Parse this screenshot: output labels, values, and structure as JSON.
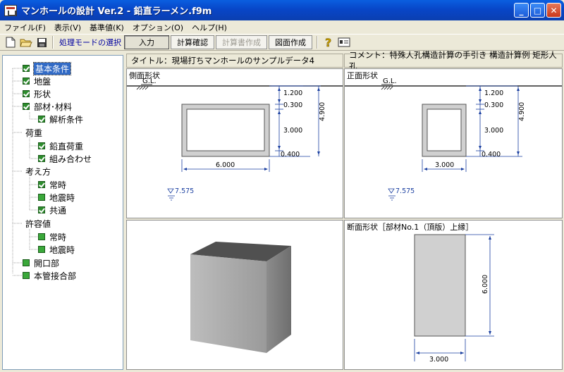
{
  "window": {
    "title": "マンホールの設計 Ver.2 - 鉛直ラーメン.f9m"
  },
  "menu": {
    "items": [
      "ファイル(F)",
      "表示(V)",
      "基準値(K)",
      "オプション(O)",
      "ヘルプ(H)"
    ]
  },
  "toolbar": {
    "mode_label": "処理モードの選択",
    "input_label": "入力",
    "calc_check_label": "計算確認",
    "calc_report_label": "計算書作成",
    "drawing_label": "図面作成"
  },
  "tree": {
    "items": [
      {
        "label": "基本条件",
        "box": "checked"
      },
      {
        "label": "地盤",
        "box": "checked"
      },
      {
        "label": "形状",
        "box": "checked"
      },
      {
        "label": "部材･材料",
        "box": "checked"
      },
      {
        "label": "解析条件",
        "box": "checked"
      },
      {
        "label": "荷重",
        "box": "none"
      },
      {
        "label": "鉛直荷重",
        "box": "checked"
      },
      {
        "label": "組み合わせ",
        "box": "checked"
      },
      {
        "label": "考え方",
        "box": "none"
      },
      {
        "label": "常時",
        "box": "checked"
      },
      {
        "label": "地震時",
        "box": "plain"
      },
      {
        "label": "共通",
        "box": "checked"
      },
      {
        "label": "許容値",
        "box": "none"
      },
      {
        "label": "常時",
        "box": "plain"
      },
      {
        "label": "地震時",
        "box": "plain"
      },
      {
        "label": "開口部",
        "box": "plain"
      },
      {
        "label": "本管接合部",
        "box": "plain"
      }
    ]
  },
  "header": {
    "title_text": "タイトル：現場打ちマンホールのサンプルデータ4",
    "comment_text": "コメント：特殊人孔構造計算の手引き 構造計算例 矩形人孔"
  },
  "side_view": {
    "title": "側面形状",
    "gl_label": "G.L.",
    "dim_top": "1.200",
    "dim_slab": "0.300",
    "dim_inner": "3.000",
    "dim_bottom": "0.400",
    "dim_total": "4.900",
    "dim_width": "6.000",
    "water_level": "7.575"
  },
  "front_view": {
    "title": "正面形状",
    "gl_label": "G.L.",
    "dim_top": "1.200",
    "dim_slab": "0.300",
    "dim_inner": "3.000",
    "dim_bottom": "0.400",
    "dim_total": "4.900",
    "dim_width": "3.000",
    "water_level": "7.575"
  },
  "section_view": {
    "title": "断面形状［部材No.1（頂版）上縁］",
    "dim_height": "6.000",
    "dim_width": "3.000"
  }
}
